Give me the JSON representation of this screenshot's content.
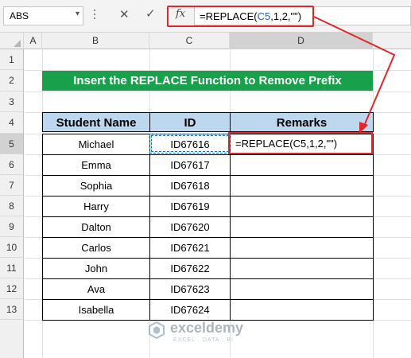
{
  "formula_bar": {
    "name_box": "ABS",
    "fx_label": "fx",
    "formula_prefix": "=REPLACE(",
    "formula_ref": "C5",
    "formula_suffix": ",1,2,\"\")"
  },
  "columns": [
    "A",
    "B",
    "C",
    "D"
  ],
  "rows": [
    "1",
    "2",
    "3",
    "4",
    "5",
    "6",
    "7",
    "8",
    "9",
    "10",
    "11",
    "12",
    "13"
  ],
  "title": "Insert the REPLACE Function to Remove Prefix",
  "table": {
    "headers": [
      "Student Name",
      "ID",
      "Remarks"
    ],
    "rows": [
      {
        "name": "Michael",
        "id": "ID67616",
        "remark": "=REPLACE(C5,1,2,\"\")"
      },
      {
        "name": "Emma",
        "id": "ID67617",
        "remark": ""
      },
      {
        "name": "Sophia",
        "id": "ID67618",
        "remark": ""
      },
      {
        "name": "Harry",
        "id": "ID67619",
        "remark": ""
      },
      {
        "name": "Dalton",
        "id": "ID67620",
        "remark": ""
      },
      {
        "name": "Carlos",
        "id": "ID67621",
        "remark": ""
      },
      {
        "name": "John",
        "id": "ID67622",
        "remark": ""
      },
      {
        "name": "Ava",
        "id": "ID67623",
        "remark": ""
      },
      {
        "name": "Isabella",
        "id": "ID67624",
        "remark": ""
      }
    ]
  },
  "watermark": {
    "name": "exceldemy",
    "tagline": "EXCEL · DATA · BI"
  },
  "colors": {
    "title_bg": "#19a04b",
    "header_bg": "#bdd7ee",
    "highlight": "#e3262b",
    "reference": "#2e5fb8"
  }
}
